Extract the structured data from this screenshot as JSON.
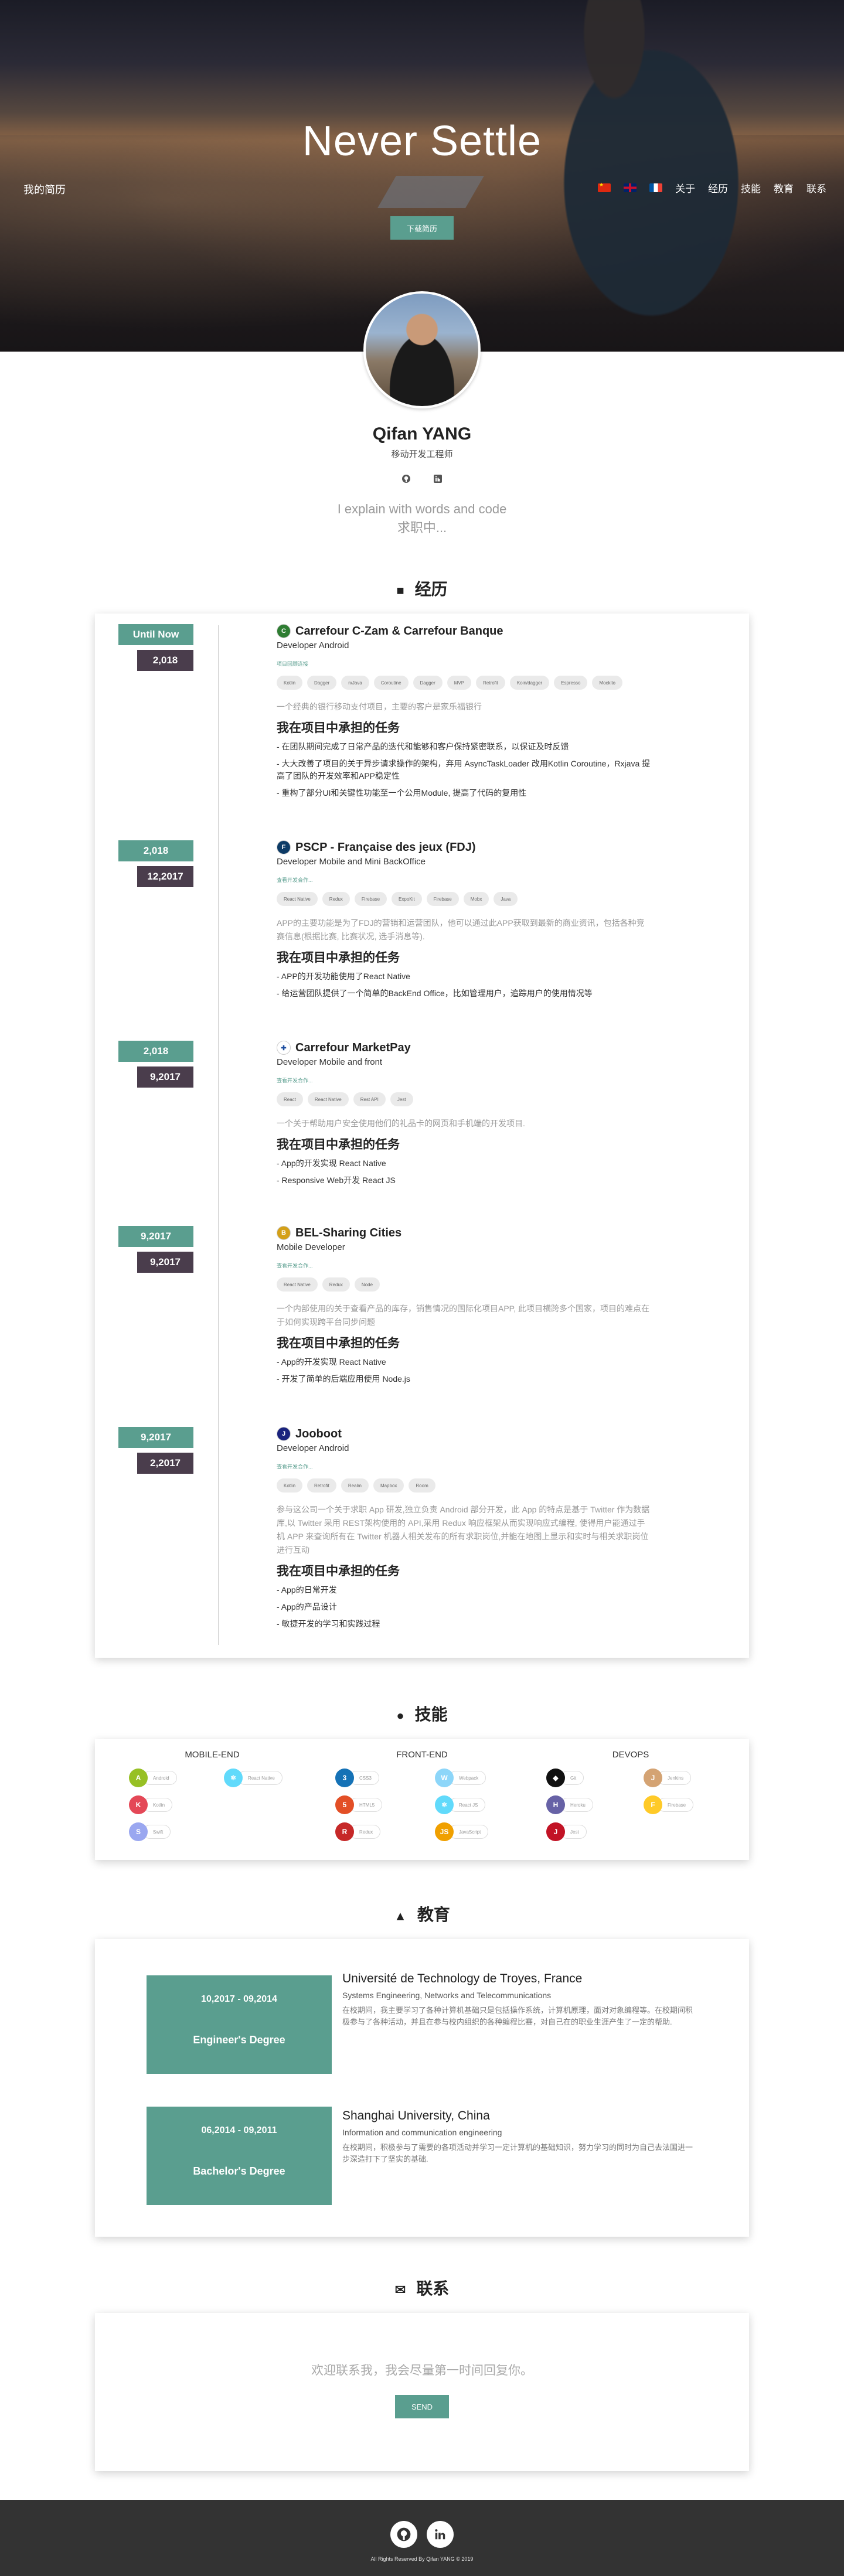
{
  "hero": {
    "title": "Never Settle",
    "download_label": "下载简历"
  },
  "nav": {
    "brand": "我的简历",
    "flags": [
      "cn",
      "gb",
      "fr"
    ],
    "items": [
      "关于",
      "经历",
      "技能",
      "教育",
      "联系"
    ]
  },
  "profile": {
    "name": "Qifan YANG",
    "role": "移动开发工程师",
    "socials": [
      "github-icon",
      "linkedin-icon"
    ],
    "tagline_1": "I explain with words and code",
    "tagline_2": "求职中..."
  },
  "experience": {
    "title": "经历",
    "jobs": [
      {
        "start": "Until Now",
        "end": "2,018",
        "company": "Carrefour C-Zam & Carrefour Banque",
        "position": "Developer Android",
        "more": "项目回顾连接",
        "tags": [
          "Kotlin",
          "Dagger",
          "rxJava",
          "Coroutine",
          "Dagger",
          "MVP",
          "Retrofit",
          "Koin/dagger",
          "Espresso",
          "Mockito"
        ],
        "desc": "一个经典的银行移动支付项目，主要的客户是家乐福银行",
        "resp_title": "我在项目中承担的任务",
        "bullets": [
          "- 在团队期间完成了日常产品的迭代和能够和客户保持紧密联系，以保证及时反馈",
          "- 大大改善了项目的关于异步请求操作的架构，弃用 AsyncTaskLoader 改用Kotlin Coroutine，Rxjava 提高了团队的开发效率和APP稳定性",
          "- 重构了部分UI和关键性功能至一个公用Module, 提高了代码的复用性"
        ]
      },
      {
        "start": "2,018",
        "end": "12,2017",
        "company": "PSCP - Française des jeux (FDJ)",
        "position": "Developer Mobile and Mini BackOffice",
        "more": "查看开发合作...",
        "tags": [
          "React Native",
          "Redux",
          "Firebase",
          "ExpoKit",
          "Firebase",
          "Mobx",
          "Java"
        ],
        "desc": "APP的主要功能是为了FDJ的营销和运营团队，他可以通过此APP获取到最新的商业资讯，包括各种竞赛信息(根据比赛, 比赛状况, 选手消息等).",
        "resp_title": "我在项目中承担的任务",
        "bullets": [
          "- APP的开发功能使用了React Native",
          "- 给运营团队提供了一个简单的BackEnd Office，比如管理用户，追踪用户的使用情况等"
        ]
      },
      {
        "start": "2,018",
        "end": "9,2017",
        "company": "Carrefour MarketPay",
        "position": "Developer Mobile and front",
        "more": "查看开发合作...",
        "tags": [
          "React",
          "React Native",
          "Rest API",
          "Jest"
        ],
        "desc": "一个关于帮助用户安全使用他们的礼品卡的网页和手机端的开发项目.",
        "resp_title": "我在项目中承担的任务",
        "bullets": [
          "- App的开发实现 React Native",
          "- Responsive Web开发 React JS"
        ]
      },
      {
        "start": "9,2017",
        "end": "9,2017",
        "company": "BEL-Sharing Cities",
        "position": "Mobile Developer",
        "more": "查看开发合作...",
        "tags": [
          "React Native",
          "Redux",
          "Node"
        ],
        "desc": "一个内部使用的关于查看产品的库存，销售情况的国际化项目APP, 此项目横跨多个国家，项目的难点在于如何实现跨平台同步问题",
        "resp_title": "我在项目中承担的任务",
        "bullets": [
          "- App的开发实现 React Native",
          "- 开发了简单的后端应用使用 Node.js"
        ]
      },
      {
        "start": "9,2017",
        "end": "2,2017",
        "company": "Jooboot",
        "position": "Developer Android",
        "more": "查看开发合作...",
        "tags": [
          "Kotlin",
          "Retrofit",
          "Realm",
          "Mapbox",
          "Room"
        ],
        "desc": "参与这公司一个关于求职 App 研发,独立负责 Android 部分开发，此 App 的特点是基于 Twitter 作为数据库,以 Twitter 采用 REST架构使用的 API,采用 Redux 响应框架从而实现响应式编程, 使得用户能通过手机 APP 来查询所有在 Twitter 机器人相关发布的所有求职岗位,并能在地图上显示和实时与相关求职岗位进行互动",
        "resp_title": "我在项目中承担的任务",
        "bullets": [
          "- App的日常开发",
          "- App的产品设计",
          "- 敏捷开发的学习和实践过程"
        ]
      }
    ]
  },
  "skills": {
    "title": "技能",
    "columns": [
      "MOBILE-END",
      "FRONT-END",
      "DEVOPS"
    ],
    "mobile": [
      {
        "name": "Android",
        "icon": "android-icon",
        "color": "#97c024",
        "glyph": "A"
      },
      {
        "name": "React Native",
        "icon": "react-icon",
        "color": "#61dafb",
        "glyph": "⚛"
      },
      {
        "name": "Kotlin",
        "icon": "kotlin-icon",
        "color": "#e44857",
        "glyph": "K"
      },
      {
        "name": "Swift",
        "icon": "swift-icon",
        "color": "#9aa7f0",
        "glyph": "S"
      }
    ],
    "front": [
      {
        "name": "CSS3",
        "icon": "css3-icon",
        "color": "#1572b6",
        "glyph": "3"
      },
      {
        "name": "Webpack",
        "icon": "webpack-icon",
        "color": "#8dd6f9",
        "glyph": "W"
      },
      {
        "name": "HTML5",
        "icon": "html5-icon",
        "color": "#e34f26",
        "glyph": "5"
      },
      {
        "name": "React JS",
        "icon": "reactjs-icon",
        "color": "#61dafb",
        "glyph": "⚛"
      },
      {
        "name": "Redux",
        "icon": "redux-icon",
        "color": "#c62828",
        "glyph": "R"
      },
      {
        "name": "JavaScript",
        "icon": "javascript-icon",
        "color": "#f0a000",
        "glyph": "JS"
      }
    ],
    "devops": [
      {
        "name": "Git",
        "icon": "git-icon",
        "color": "#111",
        "glyph": "◆"
      },
      {
        "name": "Jenkins",
        "icon": "jenkins-icon",
        "color": "#d4a373",
        "glyph": "J"
      },
      {
        "name": "Heroku",
        "icon": "heroku-icon",
        "color": "#6762a6",
        "glyph": "H"
      },
      {
        "name": "Firebase",
        "icon": "firebase-icon",
        "color": "#ffca28",
        "glyph": "F"
      },
      {
        "name": "Jest",
        "icon": "jest-icon",
        "color": "#c21325",
        "glyph": "J"
      }
    ]
  },
  "education": {
    "title": "教育",
    "items": [
      {
        "dates": "10,2017 - 09,2014",
        "degree": "Engineer's Degree",
        "school": "Université de Technology de Troyes, France",
        "major": "Systems Engineering, Networks and Telecommunications",
        "desc": "在校期间，我主要学习了各种计算机基础只是包括操作系统，计算机原理，面对对象编程等。在校期间积极参与了各种活动，并且在参与校内组织的各种编程比赛，对自己在的职业生涯产生了一定的帮助."
      },
      {
        "dates": "06,2014 - 09,2011",
        "degree": "Bachelor's Degree",
        "school": "Shanghai University, China",
        "major": "Information and communication engineering",
        "desc": "在校期间，积极参与了需要的各项活动并学习一定计算机的基础知识，努力学习的同时为自己去法国进一步深造打下了坚实的基础."
      }
    ]
  },
  "contact": {
    "title": "联系",
    "text": "欢迎联系我，我会尽量第一时间回复你。",
    "send_label": "SEND"
  },
  "footer": {
    "copyright": "All Rights Reserved By Qifan YANG © 2019"
  }
}
